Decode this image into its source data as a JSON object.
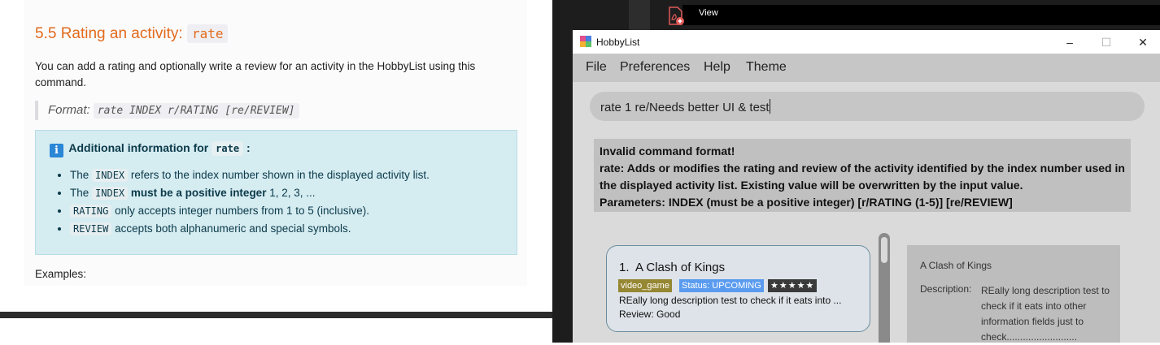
{
  "doc": {
    "heading_prefix": "5.5 Rating an activity: ",
    "heading_code": "rate",
    "paragraph": "You can add a rating and optionally write a review for an activity in the HobbyList using this command.",
    "format_label": "Format:",
    "format_code": "rate INDEX r/RATING [re/REVIEW]",
    "info_title": "Additional information for",
    "info_code": "rate",
    "info_colon": ":",
    "bullets": [
      {
        "code": "INDEX",
        "pre": "The ",
        "text": " refers to the index number shown in the displayed activity list."
      },
      {
        "code": "INDEX",
        "pre": "The ",
        "bold": "must be a positive integer",
        "text": " 1, 2, 3, ..."
      },
      {
        "code": "RATING",
        "text": " only accepts integer numbers from 1 to 5 (inclusive)."
      },
      {
        "code": "REVIEW",
        "text": " accepts both alphanumeric and special symbols."
      }
    ],
    "examples_label": "Examples:"
  },
  "ide": {
    "view_label": "View"
  },
  "app": {
    "title": "HobbyList",
    "window_controls": {
      "minimize": "–",
      "maximize": "☐",
      "close": "✕"
    },
    "menu": [
      "File",
      "Preferences",
      "Help",
      "Theme"
    ],
    "command_input": "rate 1 re/Needs better UI & test",
    "result_lines": [
      "Invalid command format!",
      "rate: Adds or modifies the rating and review of the activity identified by the index number used in",
      "the displayed activity list. Existing value will be overwritten by the input value.",
      "Parameters: INDEX (must be a positive integer) [r/RATING (1-5)] [re/REVIEW]"
    ],
    "card": {
      "index": "1.",
      "name": "A Clash of Kings",
      "type_tag": "video_game",
      "status_tag": "Status: UPCOMING",
      "stars": "★★★★★",
      "description": "REally long description test to check if it eats into ...",
      "review": "Review: Good"
    },
    "detail": {
      "title": "A Clash of Kings",
      "description_label": "Description:",
      "description": "REally long description test to check if it eats into other information fields just to check.........................."
    },
    "colors": {
      "tag_type": "#968732",
      "tag_status": "#5a9bf0",
      "card_border": "#6d8ea0"
    }
  }
}
